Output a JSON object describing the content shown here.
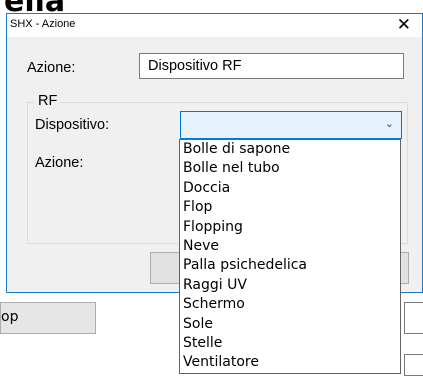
{
  "background": {
    "title_fragment": "ella",
    "button_label": "op"
  },
  "dialog": {
    "title": "SHX - Azione",
    "close_glyph": "✕",
    "azione_label": "Azione:",
    "azione_value": "Dispositivo RF",
    "group_title": "RF",
    "dispositivo_label": "Dispositivo:",
    "dispositivo_value": "",
    "azione2_label": "Azione:",
    "combo_arrow": "⌄"
  },
  "dropdown": {
    "items": [
      "Bolle di sapone",
      "Bolle nel tubo",
      "Doccia",
      "Flop",
      "Flopping",
      "Neve",
      "Palla psichedelica",
      "Raggi UV",
      "Schermo",
      "Sole",
      "Stelle",
      "Ventilatore"
    ]
  },
  "colors": {
    "dialog_border": "#1979ca",
    "combo_focus_border": "#0078d7",
    "combo_focus_bg": "#e5f1fb"
  }
}
